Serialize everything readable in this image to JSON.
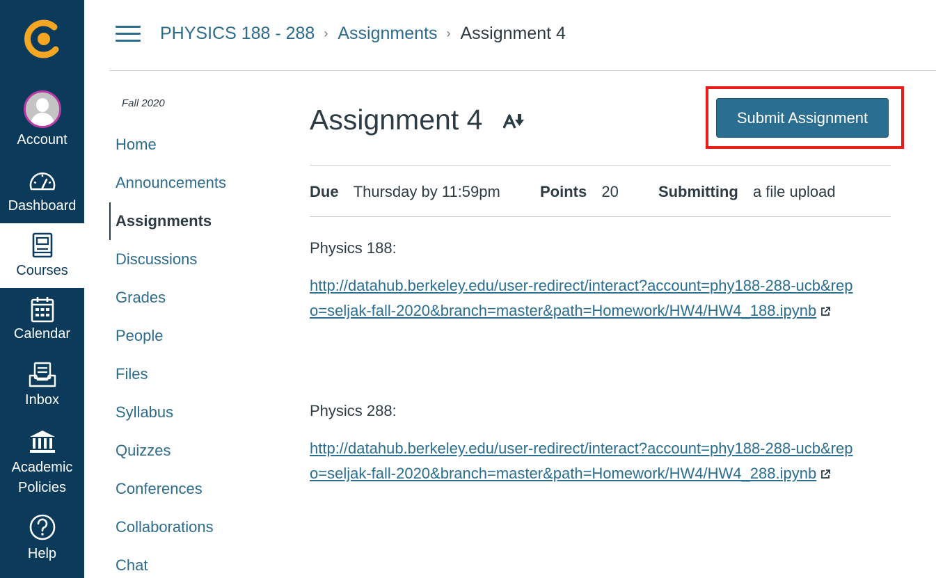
{
  "global_nav": {
    "items": [
      {
        "label": "Account"
      },
      {
        "label": "Dashboard"
      },
      {
        "label": "Courses"
      },
      {
        "label": "Calendar"
      },
      {
        "label": "Inbox"
      },
      {
        "label": "Academic Policies"
      },
      {
        "label": "Help"
      }
    ],
    "active": "Courses",
    "colors": {
      "background": "#0b3a5a",
      "logo": "#f5a623",
      "avatar_ring": "#b93ca6"
    }
  },
  "header": {
    "breadcrumb": [
      {
        "label": "PHYSICS 188 - 288"
      },
      {
        "label": "Assignments"
      },
      {
        "label": "Assignment 4"
      }
    ]
  },
  "course_nav": {
    "term": "Fall 2020",
    "items": [
      {
        "label": "Home"
      },
      {
        "label": "Announcements"
      },
      {
        "label": "Assignments"
      },
      {
        "label": "Discussions"
      },
      {
        "label": "Grades"
      },
      {
        "label": "People"
      },
      {
        "label": "Files"
      },
      {
        "label": "Syllabus"
      },
      {
        "label": "Quizzes"
      },
      {
        "label": "Conferences"
      },
      {
        "label": "Collaborations"
      },
      {
        "label": "Chat"
      }
    ],
    "active": "Assignments"
  },
  "assignment": {
    "title": "Assignment 4",
    "submit_label": "Submit Assignment",
    "due_label": "Due",
    "due_value": "Thursday by 11:59pm",
    "points_label": "Points",
    "points_value": "20",
    "submitting_label": "Submitting",
    "submitting_value": "a file upload",
    "sections": [
      {
        "heading": "Physics 188:",
        "link": "http://datahub.berkeley.edu/user-redirect/interact?account=phy188-288-ucb&repo=seljak-fall-2020&branch=master&path=Homework/HW4/HW4_188.ipynb"
      },
      {
        "heading": "Physics 288:",
        "link": "http://datahub.berkeley.edu/user-redirect/interact?account=phy188-288-ucb&repo=seljak-fall-2020&branch=master&path=Homework/HW4/HW4_288.ipynb"
      }
    ],
    "colors": {
      "button": "#2a6e91",
      "highlight": "#ea1c1c",
      "link": "#2a6e91"
    }
  }
}
